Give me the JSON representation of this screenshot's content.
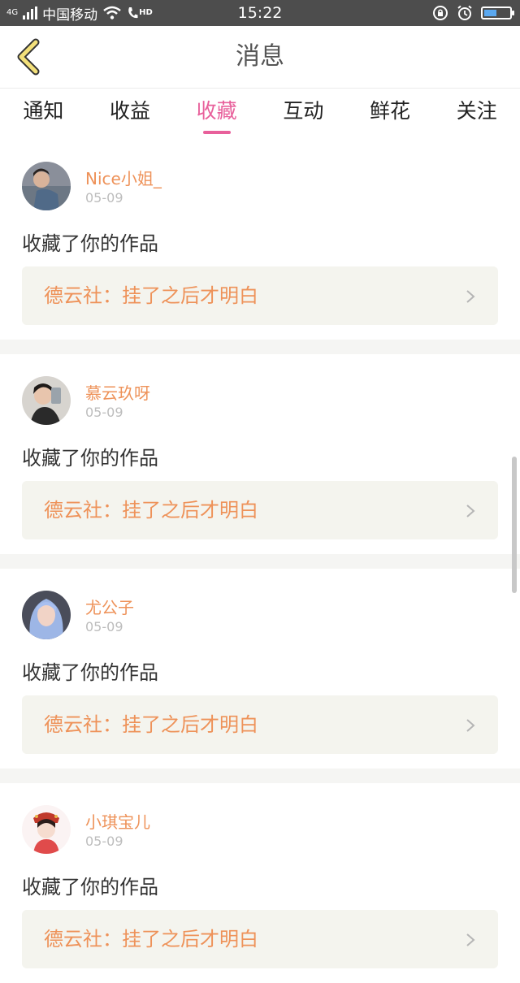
{
  "status_bar": {
    "network_type": "4G",
    "carrier": "中国移动",
    "call_badge": "HD",
    "time": "15:22"
  },
  "header": {
    "title": "消息"
  },
  "tabs": [
    {
      "label": "通知",
      "active": false
    },
    {
      "label": "收益",
      "active": false
    },
    {
      "label": "收藏",
      "active": true
    },
    {
      "label": "互动",
      "active": false
    },
    {
      "label": "鲜花",
      "active": false
    },
    {
      "label": "关注",
      "active": false
    }
  ],
  "colors": {
    "accent": "#e8609b",
    "name_orange": "#ee9259",
    "work_bg": "#f4f4ee"
  },
  "items": [
    {
      "username": "Nice小姐_",
      "date": "05-09",
      "action": "收藏了你的作品",
      "work_title": "德云社：挂了之后才明白"
    },
    {
      "username": "慕云玖呀",
      "date": "05-09",
      "action": "收藏了你的作品",
      "work_title": "德云社：挂了之后才明白"
    },
    {
      "username": "尤公子",
      "date": "05-09",
      "action": "收藏了你的作品",
      "work_title": "德云社：挂了之后才明白"
    },
    {
      "username": "小琪宝儿",
      "date": "05-09",
      "action": "收藏了你的作品",
      "work_title": "德云社：挂了之后才明白"
    }
  ]
}
